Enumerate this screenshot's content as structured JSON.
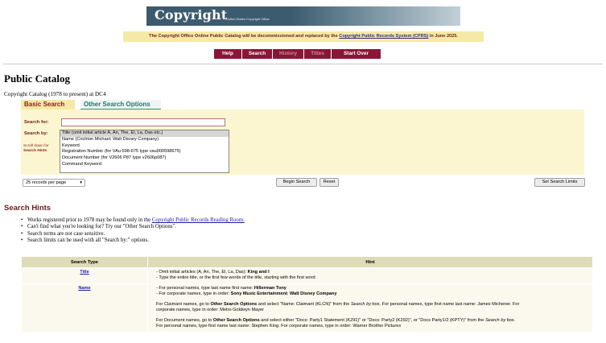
{
  "header": {
    "logo_text": "Copyright",
    "logo_sub": "United States Copyright Office"
  },
  "notice": {
    "before": "The Copyright Office Online Public Catalog will be decommissioned and replaced by the ",
    "link": "Copyright Public Records System (CPRS)",
    "after": " in June 2025."
  },
  "nav": {
    "help": "Help",
    "search": "Search",
    "history": "History",
    "titles": "Titles",
    "start_over": "Start Over"
  },
  "page": {
    "title": "Public Catalog",
    "catalog": "Copyright Catalog (1978 to present) at DC4"
  },
  "search_tabs": {
    "basic": "Basic Search",
    "other": "Other Search Options"
  },
  "form": {
    "search_for_label": "Search for:",
    "search_for_value": "",
    "search_by_label": "Search by:",
    "scroll_hint_line1": "Scroll down for",
    "scroll_hint_line2": "Search Hints",
    "options": [
      "Title (omit initial article A, An, The, El, La, Das etc.)",
      "Name (Crichton Michael; Walt Disney Company)",
      "Keyword",
      "Registration Number (for VAu 598-675 type vau000598675)",
      "Document Number (for V2606 P87 type v2606p087)",
      "Command Keyword"
    ],
    "records_per_page": "25 records per page",
    "begin_search": "Begin Search",
    "reset": "Reset",
    "set_limits": "Set Search Limits"
  },
  "hints": {
    "title": "Search Hints",
    "item1_before": "Works registered prior to 1978 may be found only in the ",
    "item1_link": "Copyright Public Records Reading Room.",
    "item2": "Can't find what you're looking for? Try our \"Other Search Options\".",
    "item3": "Search terms are not case sensitive.",
    "item4": "Search limits can be used with all \"Search by:\" options."
  },
  "table": {
    "col_type": "Search Type",
    "col_hint": "Hint",
    "rows": {
      "title": {
        "type": "Title",
        "l1_before": "- Omit initial articles (A, An, The, El, La, Das): ",
        "l1_bold": "King and I",
        "l2": "- Type the entire title, or the first few words of the title, starting with the first word"
      },
      "name": {
        "type": "Name",
        "l1_before": "- For personal names, type last name first name: ",
        "l1_bold": "Hillerman Tony",
        "l2_before": "- For corporate names, type in order: ",
        "l2_bold": "Sony Music Entertainment",
        "l2_sep": "; ",
        "l2_bold2": "Walt Disney Company",
        "p2_a": "For Claimant names, go to ",
        "p2_b": "Other Search Options",
        "p2_c": " and select \"Name: Claimant (KLCN)\" from the ",
        "p2_d": "Search by",
        "p2_e": " box. For personal names, type first name last name: James Michener. For",
        "p2_f": "corporate names, type in order: Metro Goldwyn Mayer",
        "p3_a": "For Document names, go to ",
        "p3_b": "Other Search Options",
        "p3_c": " and select either \"Docs: Party1 Statement (K291)\" or \"Docs: Party2 (K292)\", or \"Docs Party1/2 (KPTY)\" from the ",
        "p3_d": "Search by",
        "p3_e": " box.",
        "p3_f": "For personal names, type first name last name: Stephen King. For corporate names, type in order: Warner Brother Pictures"
      }
    }
  }
}
